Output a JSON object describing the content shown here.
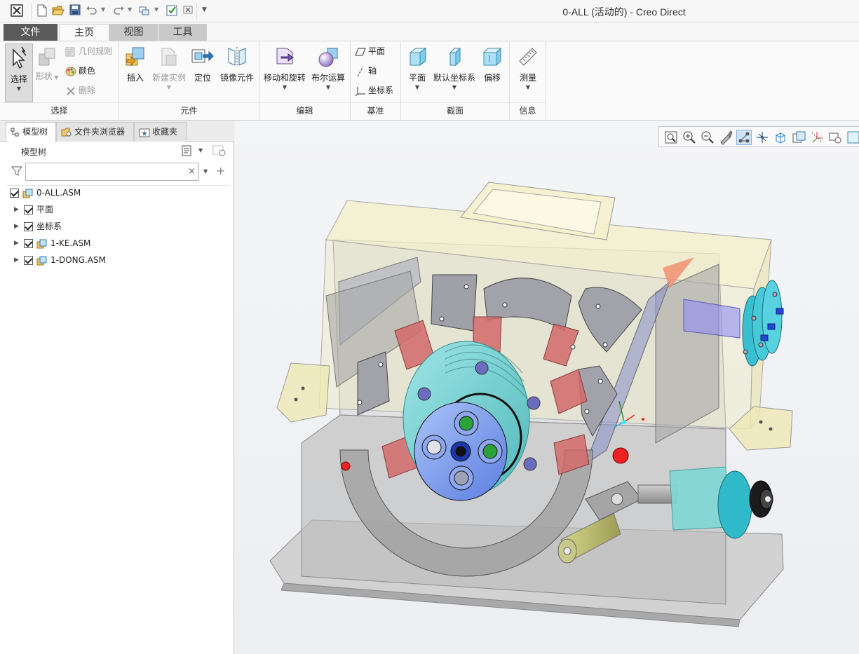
{
  "window": {
    "title": "0-ALL (活动的) - Creo Direct"
  },
  "quick_access": {
    "icons": [
      "app-icon",
      "new-icon",
      "open-icon",
      "save-icon",
      "undo-icon",
      "redo-icon",
      "windows-icon",
      "regenerate-icon",
      "close-window-icon",
      "customize-icon"
    ]
  },
  "tabs": [
    {
      "label": "文件"
    },
    {
      "label": "主页"
    },
    {
      "label": "视图"
    },
    {
      "label": "工具"
    }
  ],
  "ribbon": {
    "select": {
      "group_label": "选择",
      "select_btn": "选择",
      "shape_btn": "形状",
      "geometry_rules": "几何规则",
      "color": "颜色",
      "delete": "删除"
    },
    "component": {
      "group_label": "元件",
      "insert": "插入",
      "new_instance": "新建实例",
      "locate": "定位",
      "mirror": "镜像元件"
    },
    "edit": {
      "group_label": "编辑",
      "move_rotate": "移动和旋转",
      "boolean": "布尔运算"
    },
    "datum": {
      "group_label": "基准",
      "plane": "平面",
      "axis": "轴",
      "csys": "坐标系"
    },
    "section": {
      "group_label": "截面",
      "plane": "平面",
      "default_csys": "默认坐标系",
      "offset": "偏移"
    },
    "info": {
      "group_label": "信息",
      "measure": "测量"
    }
  },
  "left_panel": {
    "tabs": [
      {
        "label": "模型树"
      },
      {
        "label": "文件夹浏览器"
      },
      {
        "label": "收藏夹"
      }
    ],
    "tree_title": "模型树",
    "filter_value": "",
    "tree": [
      {
        "label": "0-ALL.ASM",
        "expandable": false,
        "checked": true,
        "icon": "assembly-icon"
      },
      {
        "label": "平面",
        "expandable": true,
        "checked": true,
        "icon": ""
      },
      {
        "label": "坐标系",
        "expandable": true,
        "checked": true,
        "icon": ""
      },
      {
        "label": "1-KE.ASM",
        "expandable": true,
        "checked": true,
        "icon": "assembly-icon"
      },
      {
        "label": "1-DONG.ASM",
        "expandable": true,
        "checked": true,
        "icon": "assembly-icon"
      }
    ]
  },
  "view_toolbar": {
    "icons": [
      "refit-icon",
      "zoom-in-icon",
      "zoom-out-icon",
      "repaint-icon",
      "display-style-icon",
      "spin-center-icon",
      "named-views-icon",
      "view-manager-icon",
      "datum-display-icon",
      "annotation-display-icon",
      "appearance-icon"
    ],
    "active_index": 4
  }
}
